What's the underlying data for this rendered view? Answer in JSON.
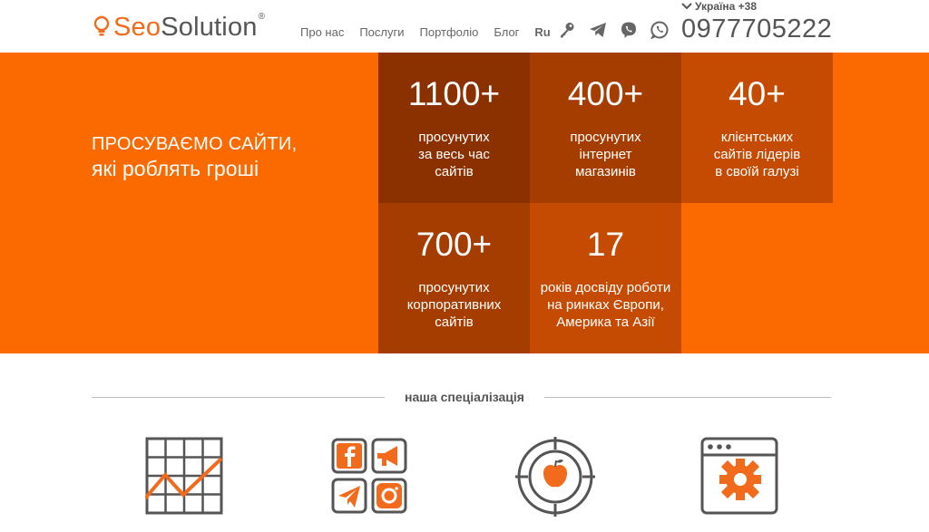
{
  "header": {
    "logo": {
      "part1": "Seo",
      "part2": "Solution",
      "reg": "®"
    },
    "nav": [
      {
        "label": "Про нас"
      },
      {
        "label": "Послуги"
      },
      {
        "label": "Портфоліо"
      },
      {
        "label": "Блог"
      },
      {
        "label": "Ru"
      }
    ],
    "social_icons": [
      "key-icon",
      "telegram-icon",
      "viber-icon",
      "whatsapp-icon"
    ],
    "country": "Україна +38",
    "phone": "0977705222"
  },
  "hero": {
    "title_line1": "ПРОСУВАЄМО САЙТИ,",
    "title_line2": "які роблять гроші",
    "stats": [
      {
        "num": "1100+",
        "l1": "просунутих",
        "l2": "за весь час",
        "l3": "сайтів"
      },
      {
        "num": "400+",
        "l1": "просунутих",
        "l2": "інтернет",
        "l3": "магазинів"
      },
      {
        "num": "40+",
        "l1": "клієнтських",
        "l2": "сайтів лідерів",
        "l3": "в своїй галузі"
      },
      {
        "num": "700+",
        "l1": "просунутих",
        "l2": "корпоративних",
        "l3": "сайтів"
      },
      {
        "num": "17",
        "l1": "років досвіду роботи",
        "l2": "на ринках Європи,",
        "l3": "Америка та Азії"
      }
    ]
  },
  "specialization": {
    "title": "наша спеціалізація",
    "icons": [
      "seo-chart-icon",
      "smm-icon",
      "target-apple-icon",
      "web-dev-gear-icon"
    ]
  },
  "colors": {
    "brand": "#fb6a00",
    "dark1": "#8b3100",
    "dark2": "#a63d00",
    "dark3": "#c64b02",
    "text": "#555555"
  }
}
